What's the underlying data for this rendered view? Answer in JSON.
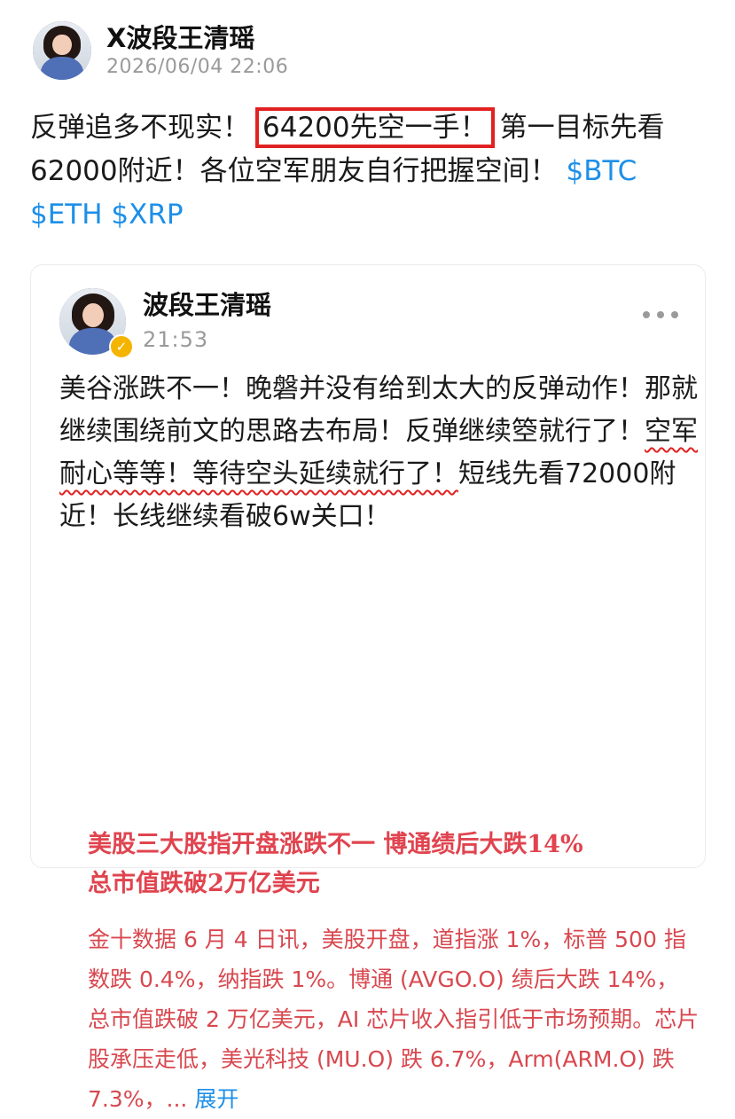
{
  "post": {
    "author": "X波段王清瑶",
    "date": "2026/06/04 22:06",
    "text_before": "反弹追多不现实！",
    "highlighted": "64200先空一手！",
    "text_after": "第一目标先看62000附近！各位空军朋友自行把握空间！",
    "tag_btc": "$BTC",
    "tag_eth": "$ETH",
    "tag_xrp": "$XRP"
  },
  "quote": {
    "author": "波段王清瑶",
    "time": "21:53",
    "text_before": "美谷涨跌不一！晚磐并没有给到太大的反弹动作！那就继续围绕前文的思路去布局！反弹继续箜就行了！",
    "text_underlined": "空军耐心等等！等待空头延续就行了！",
    "text_after": "短线先看72000附近！长线继续看破6w关口！",
    "news_headline_line1": "美股三大股指开盘涨跌不一 博通绩后大跌14%",
    "news_headline_line2": "总市值跌破2万亿美元",
    "news_body": "金十数据 6 月 4 日讯，美股开盘，道指涨 1%，标普 500 指数跌 0.4%，纳指跌 1%。博通 (AVGO.O) 绩后大跌 14%，总市值跌破 2 万亿美元，AI 芯片收入指引低于市场预期。芯片股承压走低，美光科技 (MU.O) 跌 6.7%，Arm(ARM.O) 跌 7.3%，...",
    "expand_label": "展开"
  },
  "colors": {
    "highlight_border": "#e12121",
    "tag": "#1d8fe8",
    "news_text": "#d8484f",
    "verify_badge": "#f5b400"
  },
  "icons": [
    "more-icon",
    "verified-badge-icon"
  ]
}
